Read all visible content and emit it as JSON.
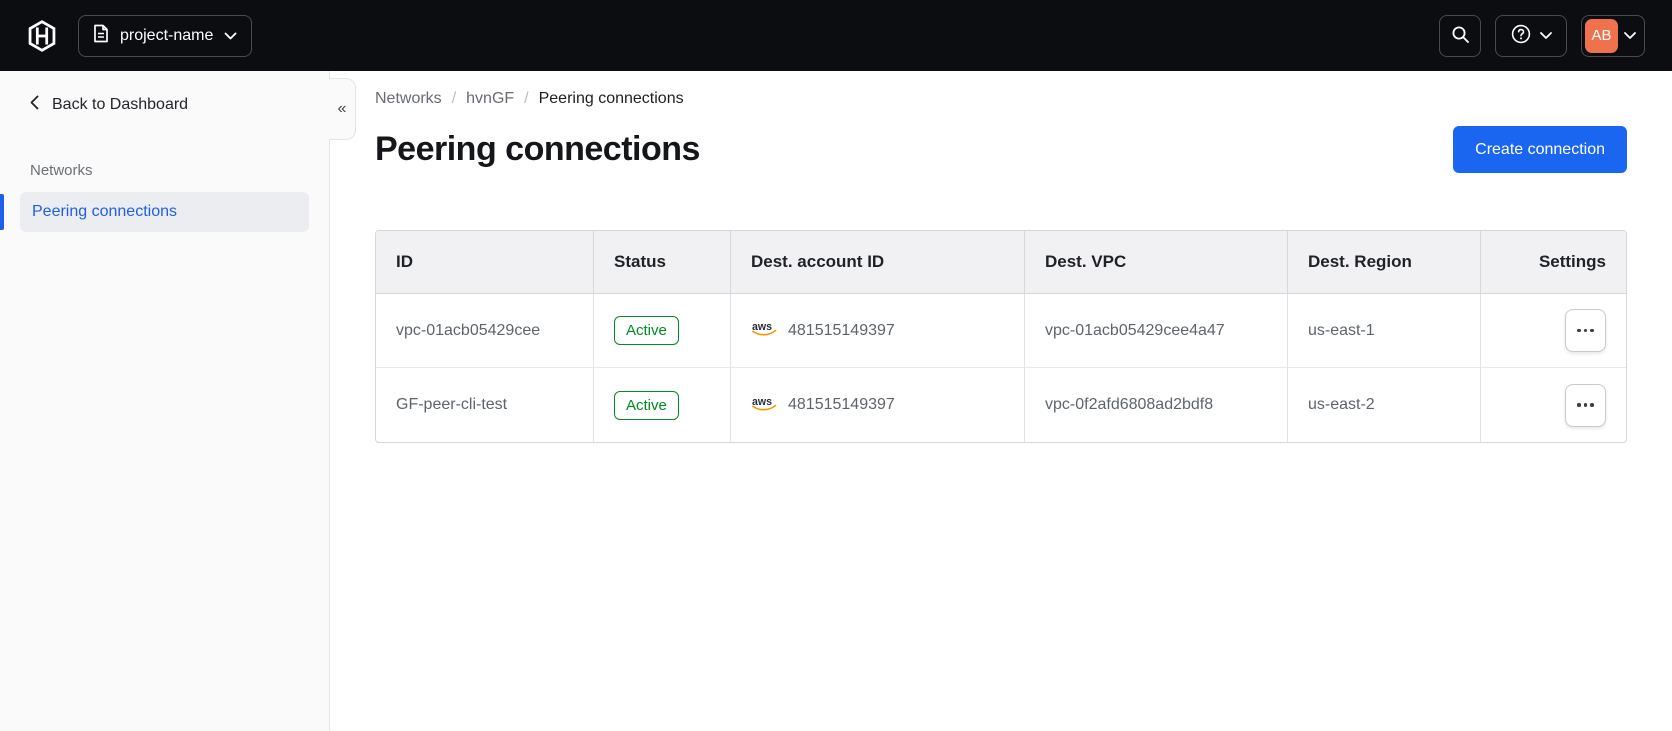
{
  "topbar": {
    "project_selector_label": "project-name",
    "avatar_initials": "AB"
  },
  "sidebar": {
    "back_label": "Back to Dashboard",
    "section_label": "Networks",
    "active_item_label": "Peering connections",
    "collapse_glyph": "«"
  },
  "breadcrumb": {
    "items": [
      "Networks",
      "hvnGF",
      "Peering connections"
    ],
    "separator": "/"
  },
  "page": {
    "title": "Peering connections",
    "create_button": "Create connection"
  },
  "table": {
    "columns": [
      "ID",
      "Status",
      "Dest. account ID",
      "Dest. VPC",
      "Dest. Region",
      "Settings"
    ],
    "rows": [
      {
        "id": "vpc-01acb05429cee",
        "status": "Active",
        "dest_account_provider": "aws",
        "dest_account_id": "481515149397",
        "dest_vpc": "vpc-01acb05429cee4a47",
        "dest_region": "us-east-1"
      },
      {
        "id": "GF-peer-cli-test",
        "status": "Active",
        "dest_account_provider": "aws",
        "dest_account_id": "481515149397",
        "dest_vpc": "vpc-0f2afd6808ad2bdf8",
        "dest_region": "us-east-2"
      }
    ]
  },
  "icons": {
    "logo": "hashicorp-logo",
    "project": "document-icon",
    "search": "search-icon",
    "help": "help-icon",
    "dropdown": "chevron-down-icon",
    "back": "chevron-left-icon",
    "collapse": "collapse-sidebar-icon",
    "provider": "aws-icon",
    "settings": "ellipsis-icon"
  },
  "colors": {
    "accent_blue": "#1b66f0",
    "status_green": "#008a22",
    "avatar_orange": "#f0714d",
    "topbar_bg": "#0c0d10"
  }
}
